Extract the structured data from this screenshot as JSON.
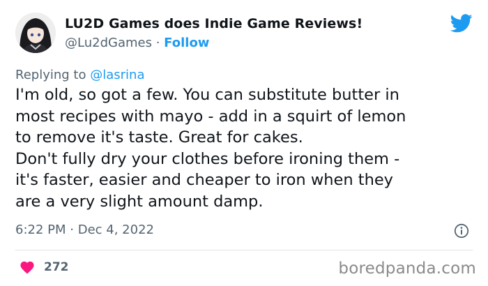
{
  "author": {
    "name": "LU2D Games does Indie Game Reviews!",
    "handle": "@Lu2dGames",
    "separator": "·",
    "follow_label": "Follow"
  },
  "icons": {
    "avatar": "anime-avatar",
    "brand": "twitter-bird-icon",
    "info": "info-icon",
    "like": "heart-icon"
  },
  "reply": {
    "prefix": "Replying to",
    "mention": "@lasrina"
  },
  "tweet": {
    "lines": [
      "I'm old, so got a few.  You can substitute butter in",
      "most recipes with mayo - add in a squirt of lemon",
      "to remove it's taste.  Great for cakes.",
      "Don't fully dry your clothes before ironing them -",
      "it's faster, easier and cheaper to iron when they",
      "are a very slight amount damp."
    ]
  },
  "meta": {
    "time": "6:22 PM",
    "separator": "·",
    "date": "Dec 4, 2022"
  },
  "likes": {
    "count": "272"
  },
  "watermark": "boredpanda.com",
  "colors": {
    "twitter_blue": "#1d9bf0",
    "heart_red": "#f91880",
    "muted_text": "#536471"
  }
}
